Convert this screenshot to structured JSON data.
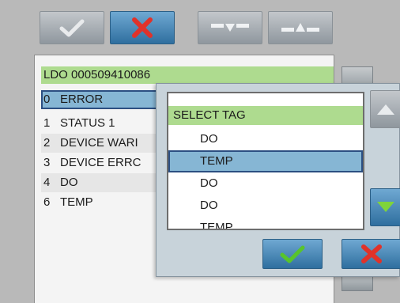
{
  "colors": {
    "header_green": "#aedb8f",
    "selection_blue": "#86b6d4",
    "selection_border": "#2c4f82",
    "check_green": "#58c42c",
    "cross_red": "#e0322a"
  },
  "toolbar": {
    "ok_icon": "check-icon",
    "cancel_icon": "cross-icon",
    "move_down_icon": "move-down-icon",
    "move_up_icon": "move-up-icon"
  },
  "list": {
    "header": "LDO 000509410086",
    "rows": [
      {
        "index": "0",
        "label": "ERROR"
      },
      {
        "index": "1",
        "label": "STATUS 1"
      },
      {
        "index": "2",
        "label": "DEVICE WARI"
      },
      {
        "index": "3",
        "label": "DEVICE ERRC"
      },
      {
        "index": "4",
        "label": "DO"
      },
      {
        "index": "6",
        "label": "TEMP"
      }
    ],
    "selected_index": 0
  },
  "dialog": {
    "title": "SELECT TAG",
    "tags": [
      "DO",
      "TEMP",
      "DO",
      "DO",
      "TEMP"
    ],
    "selected_tag_index": 1
  }
}
